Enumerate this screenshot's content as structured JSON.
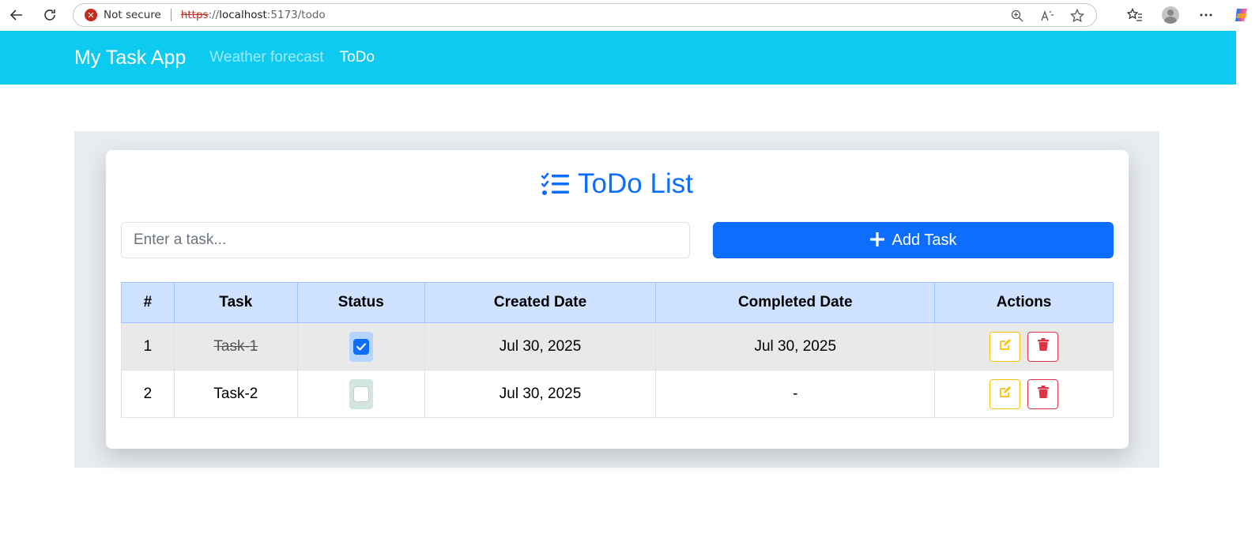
{
  "browser": {
    "security_text": "Not secure",
    "url_protocol": "https",
    "url_sep": "://",
    "url_host": "localhost",
    "url_path": ":5173/todo"
  },
  "navbar": {
    "brand": "My Task App",
    "links": [
      {
        "label": "Weather forecast",
        "active": false
      },
      {
        "label": "ToDo",
        "active": true
      }
    ],
    "bg_color": "#0dcaf0"
  },
  "card": {
    "title": "ToDo List",
    "accent_color": "#0d6efd"
  },
  "form": {
    "input_placeholder": "Enter a task...",
    "input_value": "",
    "add_button_label": "Add Task"
  },
  "table": {
    "headers": [
      "#",
      "Task",
      "Status",
      "Created Date",
      "Completed Date",
      "Actions"
    ],
    "rows": [
      {
        "index": "1",
        "task": "Task-1",
        "completed": true,
        "created": "Jul 30, 2025",
        "completed_date": "Jul 30, 2025"
      },
      {
        "index": "2",
        "task": "Task-2",
        "completed": false,
        "created": "Jul 30, 2025",
        "completed_date": "-"
      }
    ]
  },
  "icons": {
    "edit": "edit-icon",
    "delete": "trash-icon",
    "title": "list-check-icon"
  }
}
